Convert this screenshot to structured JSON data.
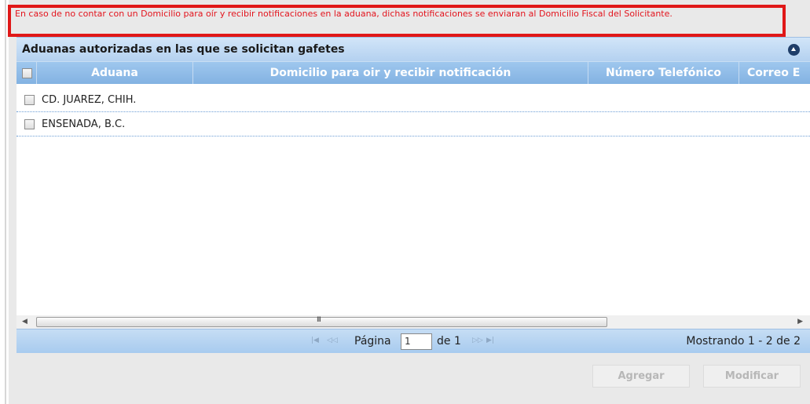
{
  "notice": {
    "text": "En caso de no contar con un Domicilio para oír y recibir notificaciones en la aduana, dichas notificaciones se enviaran al Domicilio Fiscal del Solicitante."
  },
  "grid": {
    "caption": "Aduanas autorizadas en las que se solicitan gafetes",
    "columns": {
      "aduana": "Aduana",
      "domicilio": "Domicilio para oir y recibir notificación",
      "telefono": "Número Telefónico",
      "correo": "Correo E"
    },
    "rows": [
      {
        "aduana": "CD. JUAREZ, CHIH."
      },
      {
        "aduana": "ENSENADA, B.C."
      }
    ],
    "scroll_grip": "III"
  },
  "pager": {
    "page_label": "Página",
    "page_value": "1",
    "of_label": "de 1",
    "count_text": "Mostrando 1 - 2 de 2"
  },
  "buttons": {
    "agregar": "Agregar",
    "modificar": "Modificar"
  },
  "colors": {
    "notice_border": "#e01818",
    "notice_text": "#e3141d",
    "header_blue": "#8fbbe8",
    "caption_blue": "#c3dbf4"
  }
}
